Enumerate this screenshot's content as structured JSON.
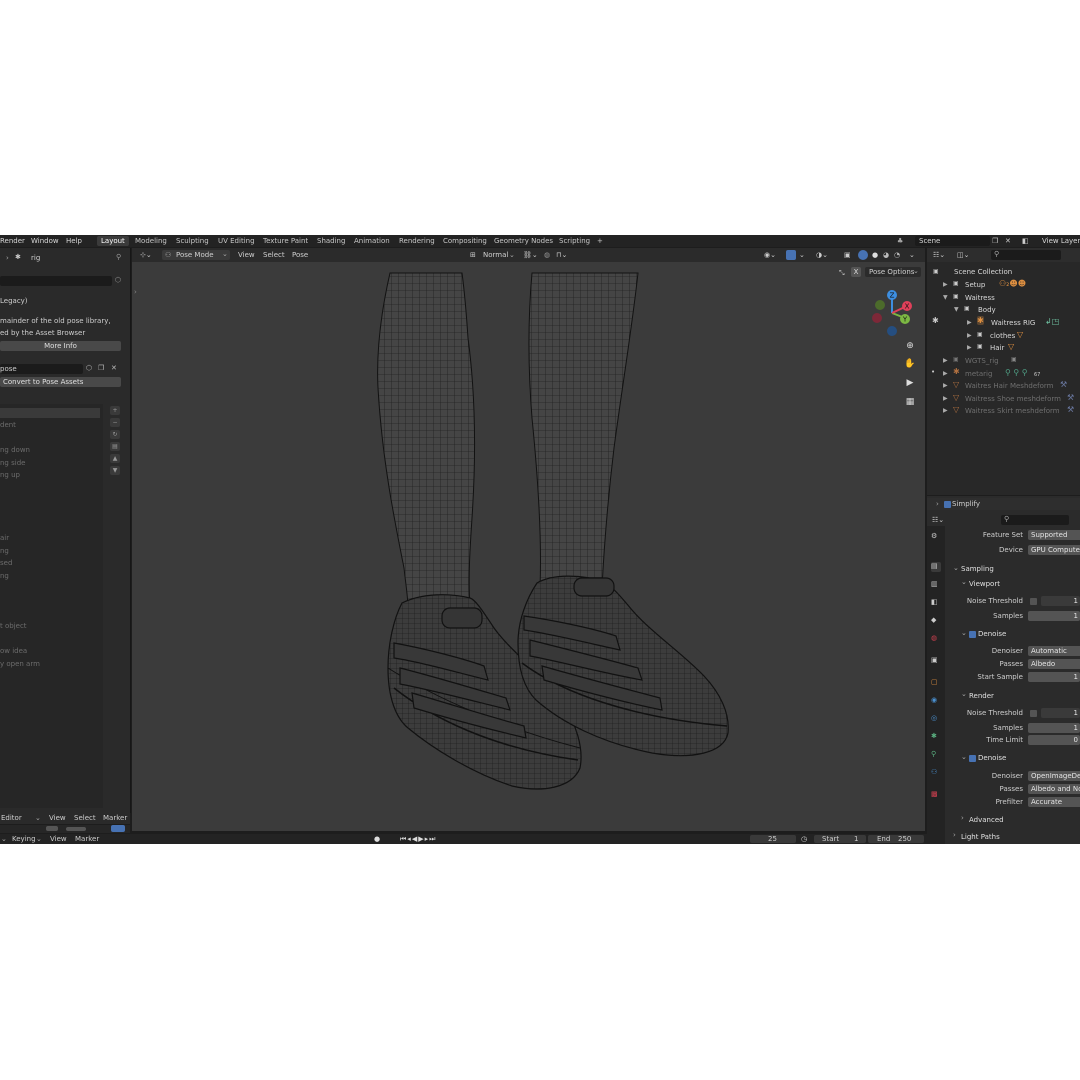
{
  "menu": {
    "render": "Render",
    "window": "Window",
    "help": "Help"
  },
  "workspaces": [
    "Layout",
    "Modeling",
    "Sculpting",
    "UV Editing",
    "Texture Paint",
    "Shading",
    "Animation",
    "Rendering",
    "Compositing",
    "Geometry Nodes",
    "Scripting"
  ],
  "workspace_add": "+",
  "scene": {
    "name": "Scene",
    "view_layer": "View Layer"
  },
  "left_panel": {
    "object_name": "rig",
    "legacy_header": "Legacy)",
    "notice_line1": "mainder of the old pose library,",
    "notice_line2": "ed by the Asset Browser",
    "more_info": "More Info",
    "pose_lib_name": "pose",
    "convert_button": "Convert to Pose Assets",
    "poses": [
      "dent",
      "",
      "ng down",
      "ng side",
      "ng up",
      "",
      "",
      "",
      "",
      "air",
      "ng",
      "sed",
      "ng",
      "",
      "",
      "t object",
      "",
      "ow idea",
      "y open arm"
    ]
  },
  "viewport": {
    "mode": "Pose Mode",
    "menus": [
      "View",
      "Select",
      "Pose"
    ],
    "orientation": "Normal",
    "pose_options": "Pose Options",
    "gizmo_axes": {
      "x": "X",
      "y": "Y",
      "z": "Z"
    }
  },
  "dopesheet": {
    "editor": "Editor",
    "view": "View",
    "select": "Select",
    "marker": "Marker"
  },
  "timeline": {
    "keying": "Keying",
    "view": "View",
    "marker": "Marker",
    "current_frame": "25",
    "start_label": "Start",
    "start": "1",
    "end_label": "End",
    "end": "250"
  },
  "outliner": {
    "rows": [
      {
        "label": "Scene Collection",
        "hidden": false
      },
      {
        "label": "Setup",
        "hidden": false
      },
      {
        "label": "Waitress",
        "hidden": false
      },
      {
        "label": "Body",
        "hidden": false
      },
      {
        "label": "Waitress RIG",
        "hidden": false
      },
      {
        "label": "clothes",
        "hidden": false
      },
      {
        "label": "Hair",
        "hidden": false
      },
      {
        "label": "WGTS_rig",
        "hidden": true
      },
      {
        "label": "metarig",
        "hidden": true
      },
      {
        "label": "Waitres Hair Meshdeform",
        "hidden": true
      },
      {
        "label": "Waitress Shoe meshdeform",
        "hidden": true
      },
      {
        "label": "Waitress Skirt meshdeform",
        "hidden": true
      }
    ],
    "badge_count": "67"
  },
  "properties": {
    "simplify": "Simplify",
    "feature_set_label": "Feature Set",
    "feature_set": "Supported",
    "device_label": "Device",
    "device": "GPU Compute",
    "sampling": "Sampling",
    "viewport": "Viewport",
    "noise_threshold_label": "Noise Threshold",
    "noise_threshold_vp": "1",
    "samples_label": "Samples",
    "samples_vp": "1",
    "denoise": "Denoise",
    "denoiser_label": "Denoiser",
    "denoiser_vp": "Automatic",
    "passes_label": "Passes",
    "passes_vp": "Albedo",
    "start_sample_label": "Start Sample",
    "start_sample": "1",
    "render": "Render",
    "noise_threshold_r": "1",
    "samples_r": "1",
    "time_limit_label": "Time Limit",
    "time_limit": "0",
    "denoiser_r": "OpenImageDen",
    "passes_r": "Albedo and Nor",
    "prefilter_label": "Prefilter",
    "prefilter": "Accurate",
    "advanced": "Advanced",
    "light_paths": "Light Paths"
  },
  "colors": {
    "accent": "#4772b3",
    "axis_x": "#e0405a",
    "axis_y": "#7cb843",
    "axis_z": "#3d8ee0",
    "object_orange": "#e09040"
  }
}
